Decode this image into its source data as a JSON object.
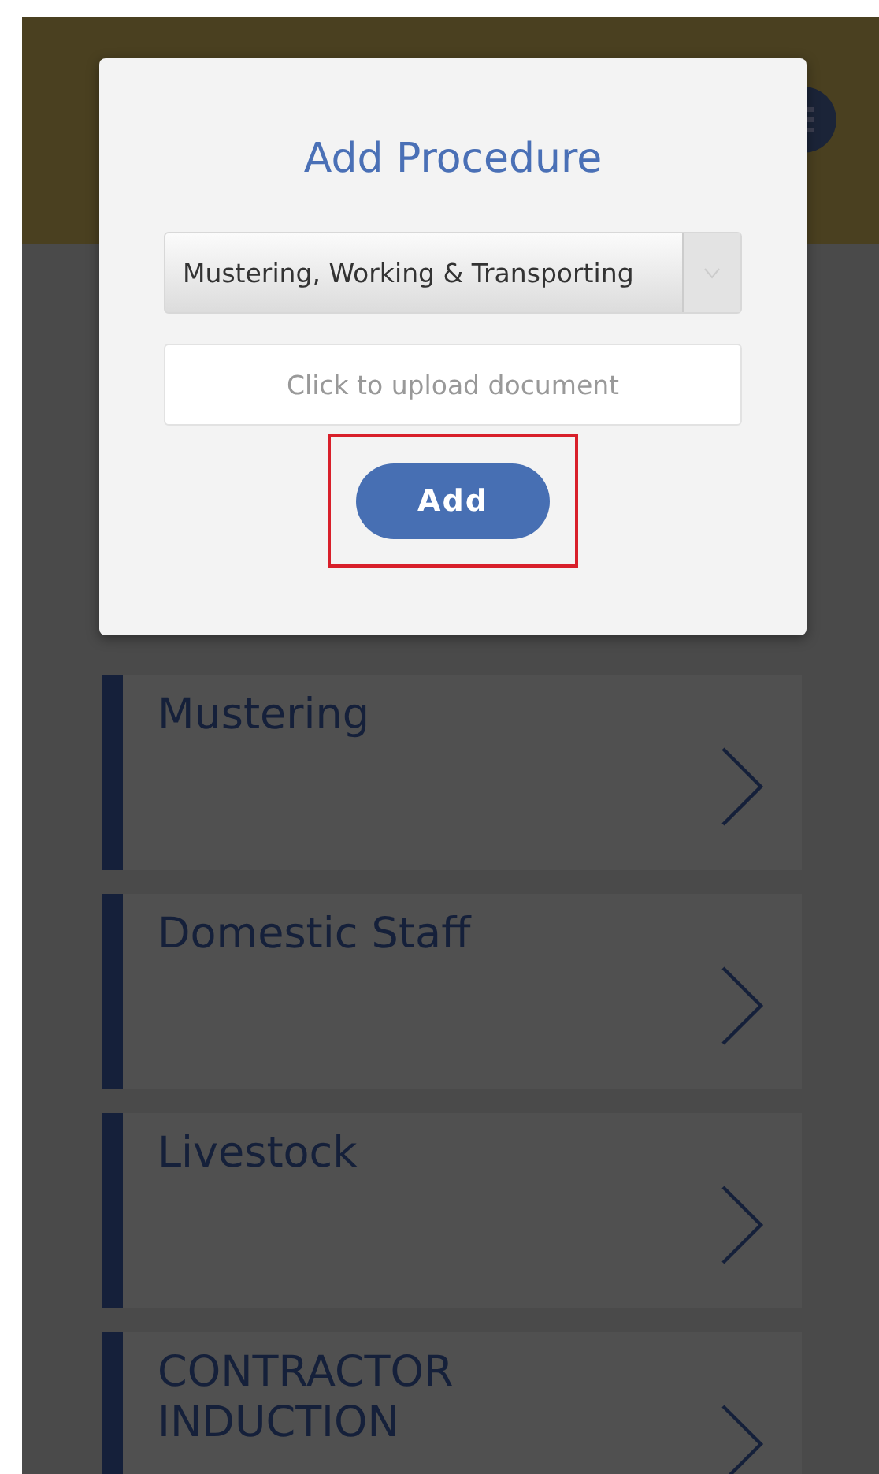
{
  "modal": {
    "title": "Add Procedure",
    "procedure_select": {
      "value": "Mustering, Working & Transporting"
    },
    "upload_field": {
      "placeholder": "Click to upload document"
    },
    "add_button": {
      "label": "Add",
      "highlighted": true
    }
  },
  "procedures": [
    {
      "title": "Mustering"
    },
    {
      "title": "Domestic Staff"
    },
    {
      "title": "Livestock"
    },
    {
      "title": "CONTRACTOR INDUCTION"
    }
  ]
}
